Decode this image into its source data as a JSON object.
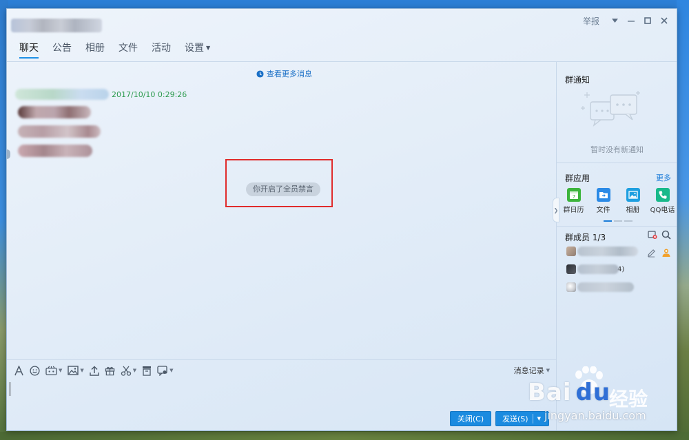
{
  "window": {
    "report_label": "举报",
    "tabs": [
      {
        "label": "聊天",
        "active": true
      },
      {
        "label": "公告",
        "active": false
      },
      {
        "label": "相册",
        "active": false
      },
      {
        "label": "文件",
        "active": false
      },
      {
        "label": "活动",
        "active": false
      },
      {
        "label": "设置",
        "active": false,
        "has_dropdown": true
      }
    ]
  },
  "chat": {
    "more_history_label": "查看更多消息",
    "message_time": "2017/10/10 0:29:26",
    "system_tip": "你开启了全员禁言"
  },
  "toolbar": {
    "history_label": "消息记录"
  },
  "buttons": {
    "close_label": "关闭(C)",
    "send_label": "发送(S)"
  },
  "sidebar": {
    "notice_title": "群通知",
    "notice_empty": "暂时没有新通知",
    "apps_title": "群应用",
    "apps_more": "更多",
    "apps": [
      {
        "label": "群日历",
        "icon": "calendar-icon",
        "color": "#3cb43c"
      },
      {
        "label": "文件",
        "icon": "folder-icon",
        "color": "#2b8ae6"
      },
      {
        "label": "相册",
        "icon": "photo-icon",
        "color": "#1e9fe0"
      },
      {
        "label": "QQ电话",
        "icon": "phone-icon",
        "color": "#18b98a"
      }
    ],
    "members_title": "群成员 1/3",
    "member_suffix": "4)"
  },
  "watermark": {
    "logo": "Bai",
    "logo2": "du",
    "sub": "经验",
    "url": "jingyan.baidu.com"
  },
  "colors": {
    "accent": "#1b8be0",
    "highlight_box": "#e02b2b",
    "time_green": "#2b9a4d"
  }
}
